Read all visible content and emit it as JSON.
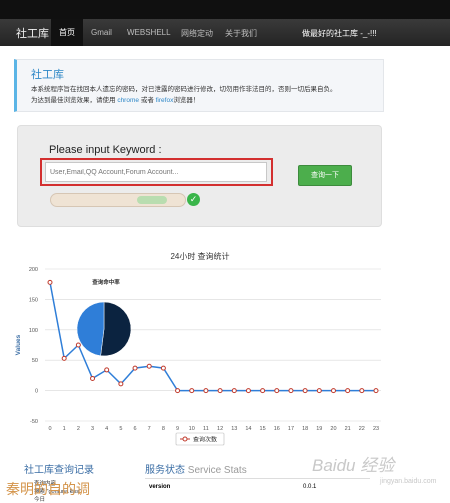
{
  "navbar": {
    "brand": "社工库",
    "items": [
      "首页",
      "Gmail",
      "WEBSHELL",
      "网络定动",
      "关于我们"
    ],
    "right_text": "做最好的社工库 -_-!!!"
  },
  "intro": {
    "title": "社工库",
    "line1": "本系统程序旨在找回本人遗忘的密码，对已泄露的密码进行修改，切勿用作非法目的，否则一切后果自负。",
    "line2_prefix": "为达到最佳浏览效果，请使用",
    "browser1": "chrome",
    "line2_mid": "或者",
    "browser2": "firefox",
    "line2_suffix": "浏览器！"
  },
  "search": {
    "heading": "Please input Keyword :",
    "placeholder": "User,Email,QQ Account,Forum Account...",
    "button_label": "查询一下",
    "check_icon": "check-circle-icon",
    "highlight_color": "#d32f2f",
    "accent_color": "#4cae4c"
  },
  "chart_data": {
    "type": "line",
    "title": "24小时 查询统计",
    "ylabel": "Values",
    "xlabel": "",
    "x": [
      0,
      1,
      2,
      3,
      4,
      5,
      6,
      7,
      8,
      9,
      10,
      11,
      12,
      13,
      14,
      15,
      16,
      17,
      18,
      19,
      20,
      21,
      22,
      23
    ],
    "series": [
      {
        "name": "查询次数",
        "color": "#2f7ed8",
        "values": [
          178,
          53,
          75,
          20,
          34,
          11,
          37,
          40,
          37,
          0,
          0,
          0,
          0,
          0,
          0,
          0,
          0,
          0,
          0,
          0,
          0,
          0,
          0,
          0
        ]
      }
    ],
    "ylim": [
      -50,
      200
    ],
    "yticks": [
      -50,
      0,
      50,
      100,
      150,
      200
    ],
    "grid": true,
    "legend": "bottom",
    "inset_pie": {
      "title": "查询命中率",
      "slices": [
        {
          "value": 52,
          "color": "#0b2340"
        },
        {
          "value": 48,
          "color": "#2f7ed8"
        }
      ]
    }
  },
  "records": {
    "title": "社工库查询记录",
    "lines": [
      "查询内容",
      "搜索 \"goniuna.kiss\"",
      "今日"
    ]
  },
  "stats": {
    "title_cn": "服务状态",
    "title_en": "Service Stats",
    "key": "version",
    "value": "0.0.1"
  },
  "watermark": {
    "text": "Baidu 经验",
    "sub": "jingyan.baidu.com"
  },
  "corner_text": "秦明的自的调"
}
